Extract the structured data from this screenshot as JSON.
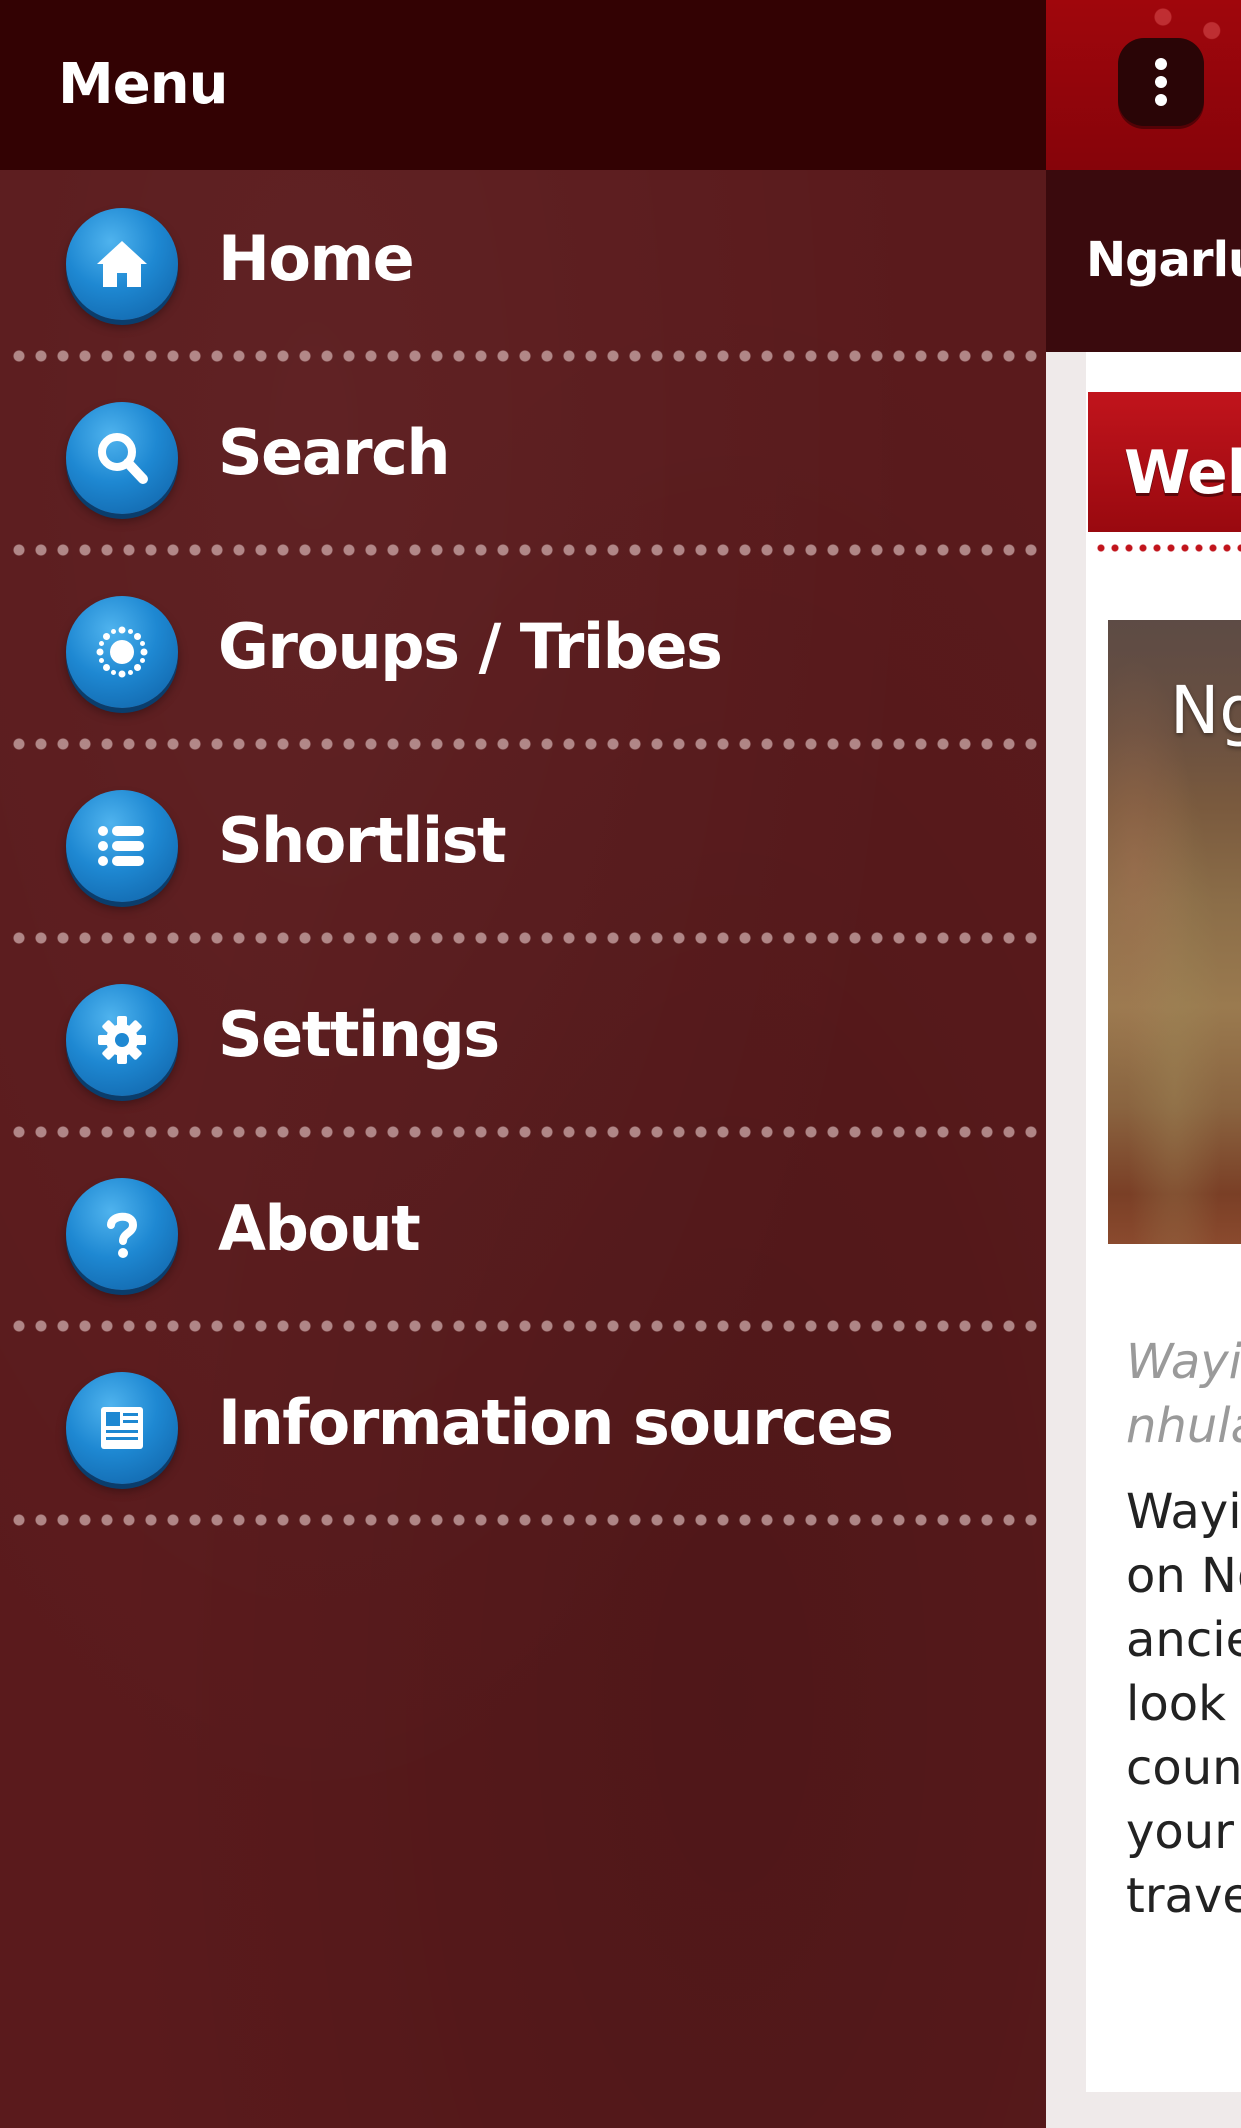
{
  "drawer": {
    "title": "Menu",
    "items": [
      {
        "label": "Home",
        "icon": "home-icon"
      },
      {
        "label": "Search",
        "icon": "search-icon"
      },
      {
        "label": "Groups / Tribes",
        "icon": "groups-icon"
      },
      {
        "label": "Shortlist",
        "icon": "list-icon"
      },
      {
        "label": "Settings",
        "icon": "gear-icon"
      },
      {
        "label": "About",
        "icon": "question-icon"
      },
      {
        "label": "Information sources",
        "icon": "document-icon"
      }
    ]
  },
  "app": {
    "subtitle": "Ngarlun",
    "welcome": "Welc",
    "hero_title": "Ng",
    "intro_italic": [
      "Wayil",
      "nhula"
    ],
    "intro_body": [
      "Wayil",
      "on Ng",
      "ancie",
      "look a",
      "count",
      "your ",
      "trave"
    ]
  },
  "colors": {
    "drawer_header": "#330203",
    "drawer_bg": "#5a1a1c",
    "icon_blue": "#1e88d2",
    "app_topbar": "#a0060c",
    "welcome_banner": "#c1141c"
  }
}
